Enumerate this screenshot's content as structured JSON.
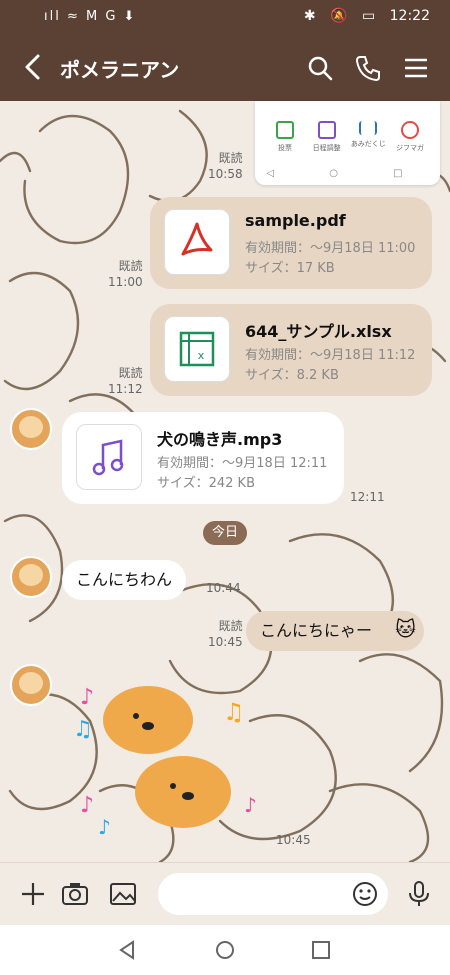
{
  "status_bar": {
    "left_icons": "ıll ≈ M G ⬇",
    "time": "12:22"
  },
  "header": {
    "title": "ポメラニアン"
  },
  "preview": {
    "apps": [
      {
        "label": "投票",
        "color": "#3aa44b"
      },
      {
        "label": "日程調整",
        "color": "#7a52c4"
      },
      {
        "label": "あみだくじ",
        "color": "#2a6fd6"
      },
      {
        "label": "ジフマガ",
        "color": "#e84a4a"
      }
    ],
    "nav": "◁ ○ □"
  },
  "messages": [
    {
      "kind": "meta-me",
      "read": "既読",
      "time": "10:58"
    },
    {
      "kind": "file-me",
      "name": "sample.pdf",
      "expiry": "有効期間：〜9月18日 11:00",
      "size": "サイズ：17 KB",
      "read": "既読",
      "time": "11:00",
      "icon": "pdf-icon"
    },
    {
      "kind": "file-me",
      "name": "644_サンプル.xlsx",
      "expiry": "有効期間：〜9月18日 11:12",
      "size": "サイズ：8.2 KB",
      "read": "既読",
      "time": "11:12",
      "icon": "excel-icon"
    },
    {
      "kind": "file-other",
      "name": "犬の鳴き声.mp3",
      "expiry": "有効期間：〜9月18日 12:11",
      "size": "サイズ：242 KB",
      "time": "12:11",
      "icon": "music-icon"
    },
    {
      "kind": "date",
      "label": "今日"
    },
    {
      "kind": "text-other",
      "text": "こんにちわん",
      "time": "10:44"
    },
    {
      "kind": "text-me",
      "text": "こんにちにゃー",
      "read": "既読",
      "time": "10:45"
    },
    {
      "kind": "sticker-other",
      "time": "10:45"
    }
  ],
  "colors": {
    "header": "#5b4134",
    "bubble_me": "#e8d6c4",
    "chat_bg": "#f1ebe3",
    "date_chip": "#8b6b55"
  }
}
